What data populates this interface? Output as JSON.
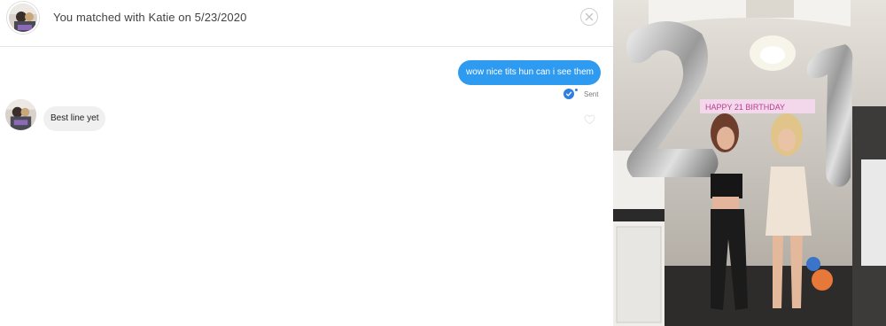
{
  "header": {
    "title": "You matched with Katie on 5/23/2020",
    "avatar_alt": "Katie profile photo"
  },
  "messages": [
    {
      "direction": "outgoing",
      "text": "wow nice tits hun can i see them",
      "status": "Sent"
    },
    {
      "direction": "incoming",
      "text": "Best line yet"
    }
  ],
  "icons": {
    "close": "close-icon",
    "sent": "check-circle-icon",
    "like": "heart-outline-icon"
  },
  "photo": {
    "banner_text": "HAPPY 21 BIRTHDAY",
    "balloon_digits": "21"
  },
  "colors": {
    "outgoing_bubble": "#2e9bf0",
    "incoming_bubble": "#f0f0f0",
    "sent_check": "#2e7fe0"
  }
}
